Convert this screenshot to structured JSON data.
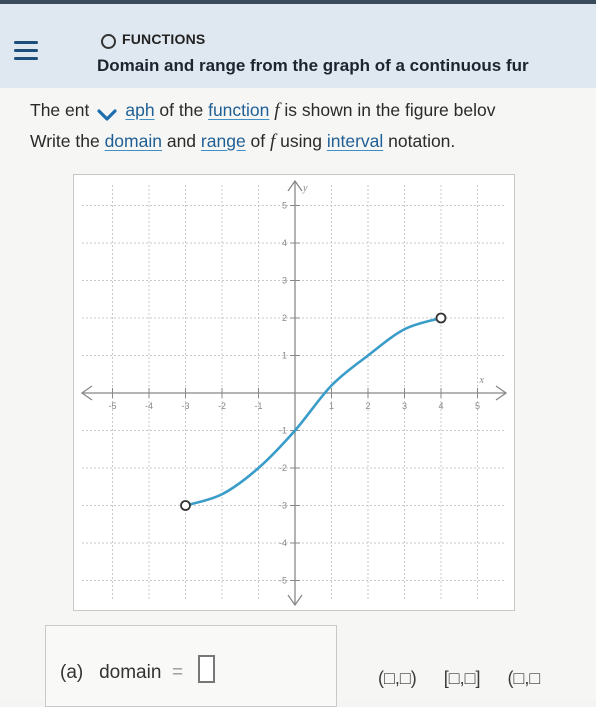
{
  "header": {
    "topic": "FUNCTIONS",
    "title": "Domain and range from the graph of a continuous fur"
  },
  "question": {
    "line1_pre": "The ent",
    "line1_a": "aph",
    "line1_b": " of the ",
    "line1_link": "function",
    "line1_f": "f",
    "line1_c": " is shown in the figure belov",
    "line2_a": "Write the ",
    "line2_domain": "domain",
    "line2_b": " and ",
    "line2_range": "range",
    "line2_c": " of ",
    "line2_f": "f",
    "line2_d": " using ",
    "line2_interval": "interval",
    "line2_e": " notation."
  },
  "answer": {
    "part_label": "(a)",
    "domain_label": "domain",
    "equals": "="
  },
  "palette": {
    "btn1": "(□,□)",
    "btn2": "[□,□]",
    "btn3": "(□,□"
  },
  "graph": {
    "x_label": "x",
    "y_label": "y",
    "x_ticks": [
      "-5",
      "-4",
      "-3",
      "-2",
      "-1",
      "1",
      "2",
      "3",
      "4",
      "5"
    ],
    "y_ticks": [
      "5",
      "4",
      "3",
      "2",
      "1",
      "-1",
      "-2",
      "-3",
      "-4",
      "-5"
    ],
    "curve_color": "#3a9cc9",
    "x_range": [
      -5,
      5
    ],
    "y_range": [
      -5,
      5
    ],
    "start_point": {
      "x": -3,
      "y": -3,
      "open": true
    },
    "end_point": {
      "x": 4,
      "y": 2,
      "open": true
    },
    "curve_points": [
      [
        -3,
        -3
      ],
      [
        -2,
        -2.7
      ],
      [
        -1,
        -2
      ],
      [
        0,
        -1
      ],
      [
        1,
        0.2
      ],
      [
        2,
        1
      ],
      [
        3,
        1.7
      ],
      [
        4,
        2
      ]
    ]
  }
}
